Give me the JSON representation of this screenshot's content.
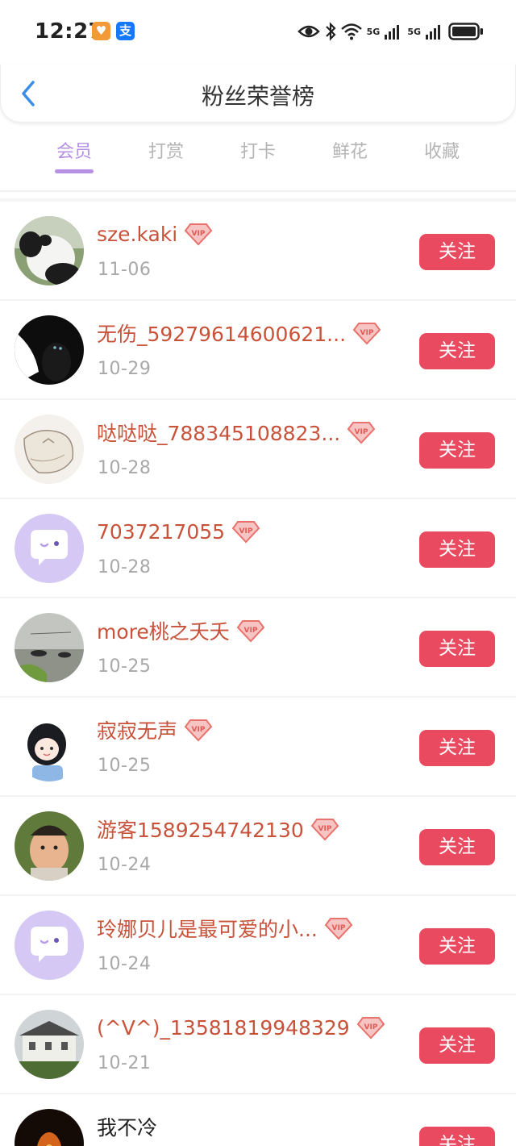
{
  "status_bar": {
    "time": "12:27",
    "app_icons": [
      "taobao-icon",
      "alipay-icon"
    ],
    "app_icon_glyphs": [
      "♥",
      "支"
    ],
    "network_labels": [
      "5G",
      "5G"
    ]
  },
  "header": {
    "title": "粉丝荣誉榜",
    "back_icon": "chevron-left-icon"
  },
  "tabs": [
    {
      "label": "会员",
      "active": true
    },
    {
      "label": "打赏",
      "active": false
    },
    {
      "label": "打卡",
      "active": false
    },
    {
      "label": "鲜花",
      "active": false
    },
    {
      "label": "收藏",
      "active": false
    }
  ],
  "colors": {
    "accent": "#b590e4",
    "follow_button": "#ea4a5f",
    "username": "#c8523a",
    "date": "#a8a8a8"
  },
  "fans": [
    {
      "name": "sze.kaki",
      "date": "11-06",
      "vip": true,
      "avatar": "panda-photo",
      "follow_label": "关注"
    },
    {
      "name": "无伤_59279614600621...",
      "date": "10-29",
      "vip": true,
      "avatar": "black-cat-photo",
      "follow_label": "关注"
    },
    {
      "name": "哒哒哒_788345108823...",
      "date": "10-28",
      "vip": true,
      "avatar": "sketch-drawing",
      "follow_label": "关注"
    },
    {
      "name": "7037217055",
      "date": "10-28",
      "vip": true,
      "avatar": "default-chat-avatar",
      "follow_label": "关注"
    },
    {
      "name": "more桃之夭夭",
      "date": "10-25",
      "vip": true,
      "avatar": "swans-lake-photo",
      "follow_label": "关注"
    },
    {
      "name": "寂寂无声",
      "date": "10-25",
      "vip": true,
      "avatar": "anime-girl",
      "follow_label": "关注"
    },
    {
      "name": "游客1589254742130",
      "date": "10-24",
      "vip": true,
      "avatar": "child-photo",
      "follow_label": "关注"
    },
    {
      "name": "玲娜贝儿是最可爱的小...",
      "date": "10-24",
      "vip": true,
      "avatar": "default-chat-avatar",
      "follow_label": "关注"
    },
    {
      "name": "(^V^)_13581819948329",
      "date": "10-21",
      "vip": true,
      "avatar": "building-photo",
      "follow_label": "关注"
    },
    {
      "name": "我不冷",
      "date": "",
      "vip": false,
      "avatar": "fire-photo",
      "follow_label": "关注"
    }
  ]
}
